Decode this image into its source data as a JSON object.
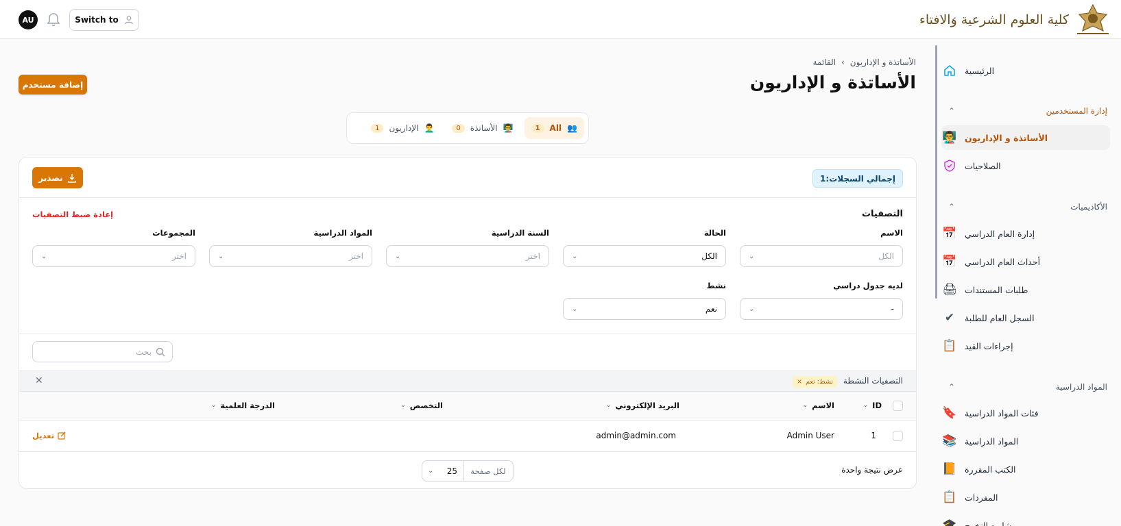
{
  "topbar": {
    "avatar_initials": "AU",
    "switch_label": "Switch to",
    "logo_text": "كلية العلوم الشرعية والافتاء"
  },
  "sidebar": {
    "home": "الرئيسية",
    "group_users": "إدارة المستخدمين",
    "teachers_admins": "الأساتذة و الإداريون",
    "permissions": "الصلاحيات",
    "group_academics": "الأكاديميات",
    "academic_year": "إدارة العام الدراسي",
    "academic_events": "أحداث العام الدراسي",
    "doc_requests": "طلبات المستندات",
    "student_record": "السجل العام للطلبة",
    "enrollment": "إجراءات القيد",
    "group_courses": "المواد الدراسية",
    "course_categories": "فئات المواد الدراسية",
    "courses": "المواد الدراسية",
    "textbooks": "الكتب المقررة",
    "syllabus": "المفردات",
    "graduation_projects": "مشاريع التخرج"
  },
  "header": {
    "breadcrumb_root": "الأساتذة و الإداريون",
    "breadcrumb_current": "القائمة",
    "title": "الأساتذة و الإداريون",
    "add_user": "إضافة مستخدم"
  },
  "tabs": [
    {
      "label": "All",
      "count": "1"
    },
    {
      "label": "الأساتذة",
      "count": "0"
    },
    {
      "label": "الإداريون",
      "count": "1"
    }
  ],
  "panel": {
    "export": "تصدير",
    "total_records": "إجمالي السجلات:1"
  },
  "filters": {
    "title": "التصفيات",
    "reset": "إعادة ضبط التصفيات",
    "name_label": "الاسم",
    "name_placeholder": "الكل",
    "status_label": "الحالة",
    "status_value": "الكل",
    "year_label": "السنة الدراسية",
    "year_placeholder": "اختر",
    "subjects_label": "المواد الدراسية",
    "subjects_placeholder": "اختر",
    "groups_label": "المجموعات",
    "groups_placeholder": "اختر",
    "schedule_label": "لديه جدول دراسي",
    "schedule_value": "-",
    "active_label": "نشط",
    "active_value": "نعم"
  },
  "search": {
    "placeholder": "بحث"
  },
  "active_filters": {
    "label": "التصفيات النشطة",
    "chip": "نشط: نعم"
  },
  "table": {
    "columns": {
      "id": "ID",
      "name": "الاسم",
      "email": "البريد الإلكتروني",
      "specialty": "التخصص",
      "degree": "الدرجة العلمية"
    },
    "rows": [
      {
        "id": "1",
        "name": "Admin User",
        "email": "admin@admin.com",
        "specialty": "",
        "degree": "",
        "action": "تعديل"
      }
    ]
  },
  "footer": {
    "results": "عرض نتيجة واحدة",
    "per_page_value": "25",
    "per_page_label": "لكل صفحة"
  },
  "colors": {
    "accent": "#d97706",
    "danger": "#dc2626",
    "info_bg": "#e0f2fe"
  }
}
